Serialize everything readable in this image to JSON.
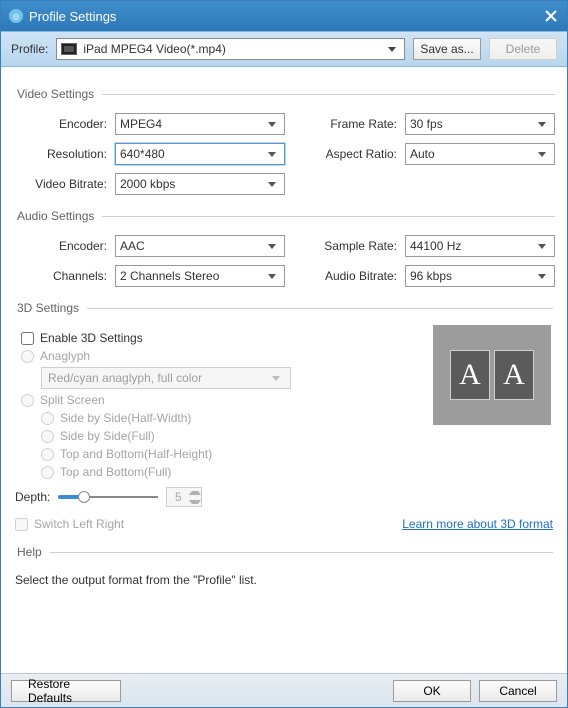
{
  "window": {
    "title": "Profile Settings"
  },
  "profilebar": {
    "label": "Profile:",
    "value": "iPad MPEG4 Video(*.mp4)",
    "save_as": "Save as...",
    "delete": "Delete"
  },
  "video": {
    "legend": "Video Settings",
    "encoder_label": "Encoder:",
    "encoder": "MPEG4",
    "resolution_label": "Resolution:",
    "resolution": "640*480",
    "bitrate_label": "Video Bitrate:",
    "bitrate": "2000 kbps",
    "framerate_label": "Frame Rate:",
    "framerate": "30 fps",
    "aspect_label": "Aspect Ratio:",
    "aspect": "Auto"
  },
  "audio": {
    "legend": "Audio Settings",
    "encoder_label": "Encoder:",
    "encoder": "AAC",
    "channels_label": "Channels:",
    "channels": "2 Channels Stereo",
    "samplerate_label": "Sample Rate:",
    "samplerate": "44100 Hz",
    "bitrate_label": "Audio Bitrate:",
    "bitrate": "96 kbps"
  },
  "three_d": {
    "legend": "3D Settings",
    "enable": "Enable 3D Settings",
    "anaglyph": "Anaglyph",
    "anaglyph_mode": "Red/cyan anaglyph, full color",
    "split": "Split Screen",
    "sbs_half": "Side by Side(Half-Width)",
    "sbs_full": "Side by Side(Full)",
    "tab_half": "Top and Bottom(Half-Height)",
    "tab_full": "Top and Bottom(Full)",
    "depth_label": "Depth:",
    "depth_value": "5",
    "switch_lr": "Switch Left Right",
    "learn_more": "Learn more about 3D format",
    "preview_glyph": "A"
  },
  "help": {
    "legend": "Help",
    "text": "Select the output format from the \"Profile\" list."
  },
  "footer": {
    "restore": "Restore Defaults",
    "ok": "OK",
    "cancel": "Cancel"
  }
}
